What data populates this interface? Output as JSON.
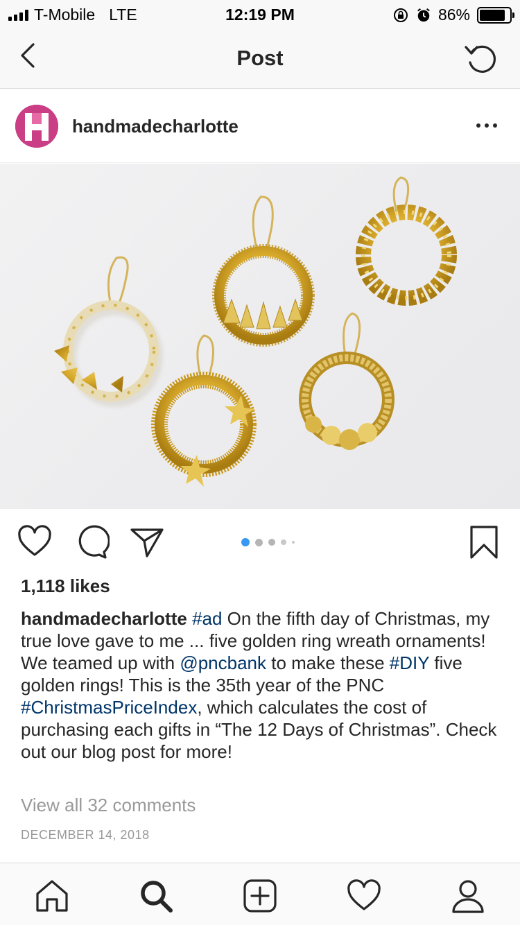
{
  "status_bar": {
    "carrier": "T-Mobile",
    "network": "LTE",
    "time": "12:19 PM",
    "battery_percent": "86%",
    "battery_level": 0.86,
    "icons": [
      "signal-icon",
      "orientation-lock-icon",
      "alarm-icon",
      "battery-icon"
    ]
  },
  "nav": {
    "title": "Post",
    "back_icon": "chevron-left-icon",
    "refresh_icon": "refresh-icon"
  },
  "post": {
    "username": "handmadecharlotte",
    "avatar_letter": "H",
    "avatar_color": "#c93e84",
    "more_icon": "more-horizontal-icon",
    "image_description_icon": "photo",
    "carousel": {
      "count": 5,
      "active_index": 0,
      "active_color": "#3897f0"
    },
    "likes": "1,118 likes",
    "caption": {
      "username": "handmadecharlotte",
      "seg1": "#ad",
      "seg2": " On the fifth day of Christmas, my true love gave to me ... five golden ring wreath ornaments! We teamed up with ",
      "seg3": "@pncbank",
      "seg4": " to make these ",
      "seg5": "#DIY",
      "seg6": " five golden rings! This is the 35th year of the PNC ",
      "seg7": "#ChristmasPriceIndex",
      "seg8": ", which calculates the cost of purchasing each gifts in “The 12 Days of Christmas”. Check out our blog post for more!"
    },
    "view_comments": "View all 32 comments",
    "date": "DECEMBER 14, 2018",
    "link_color": "#003569"
  },
  "tab_bar": {
    "items": [
      "home-icon",
      "search-icon",
      "add-post-icon",
      "activity-heart-icon",
      "profile-icon"
    ]
  }
}
